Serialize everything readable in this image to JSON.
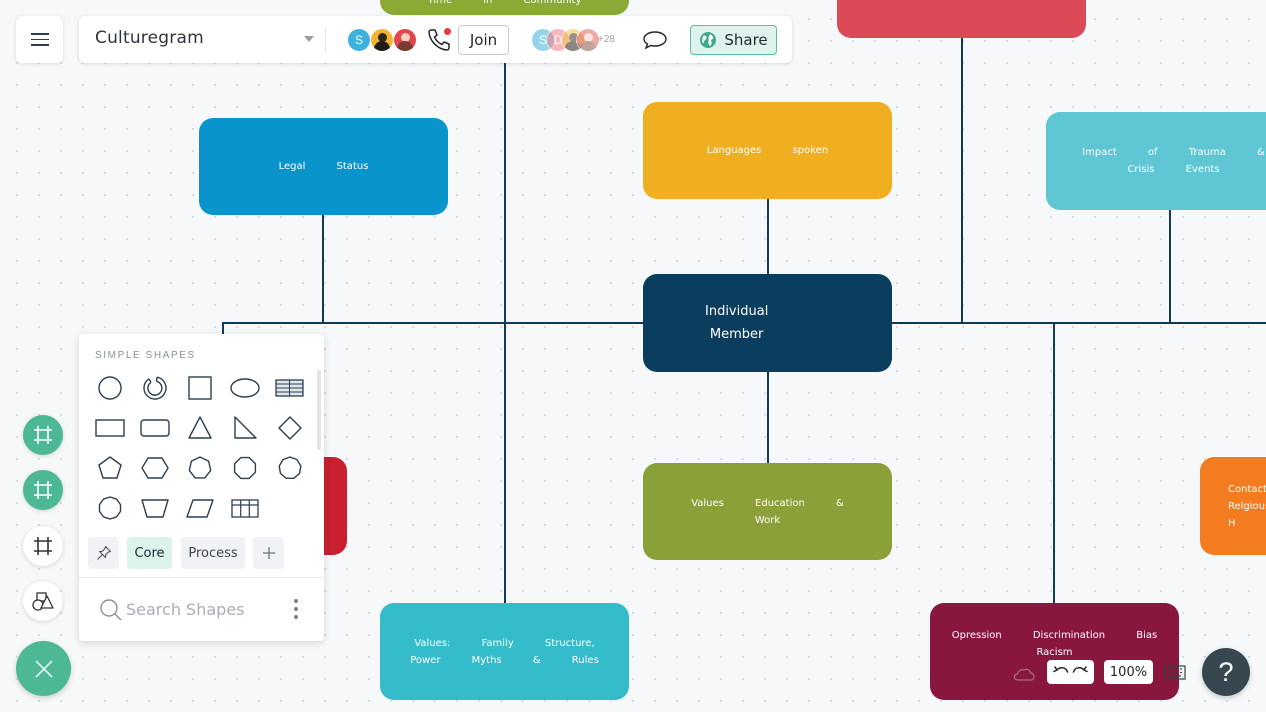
{
  "app": {
    "document_title": "Culturegram",
    "menu_icon": "hamburger-menu-icon"
  },
  "topbar": {
    "collaborators_in_call": [
      {
        "initial": "S",
        "color": "#3fb1de"
      },
      {
        "initial": "",
        "color": "#f2b531",
        "photo": true
      },
      {
        "initial": "",
        "color": "#e2474f",
        "photo": true
      }
    ],
    "call_icon": "phone-call-icon",
    "join_label": "Join",
    "viewers": [
      {
        "initial": "S",
        "color": "#3fb1de"
      },
      {
        "initial": "D",
        "color": "#ef7d86"
      },
      {
        "initial": "",
        "color": "#f2c34a",
        "photo": true
      },
      {
        "initial": "",
        "color": "#e0655f",
        "photo": true
      }
    ],
    "viewers_more": "+28",
    "comment_icon": "comment-bubble-icon",
    "share_label": "Share",
    "share_icon": "globe-icon"
  },
  "diagram": {
    "center_node": {
      "lines": [
        "Individual",
        "Member"
      ],
      "color": "#0b3d5e"
    },
    "nodes": [
      {
        "id": "time-in-community",
        "text": "Time in Community",
        "color": "#8aaa35"
      },
      {
        "id": "top-red",
        "text": "",
        "color": "#db4a56"
      },
      {
        "id": "legal-status",
        "text": "Legal Status",
        "color": "#0a94cc"
      },
      {
        "id": "languages-spoken",
        "text": "Languages spoken",
        "color": "#f0ae21"
      },
      {
        "id": "impact-of-trauma",
        "text": "Impact of Trauma & Crisis Events",
        "color": "#5ec7d3"
      },
      {
        "id": "left-red",
        "text": "",
        "color": "#c9202f"
      },
      {
        "id": "values-education-work",
        "text": "Values Education & Work",
        "color": "#8ca03a"
      },
      {
        "id": "contact-religious",
        "text": "Contact Relgious H",
        "color": "#f47c20"
      },
      {
        "id": "values-family",
        "text": "Values: Family Structure, Power Myths & Rules",
        "color": "#34bccb"
      },
      {
        "id": "opression",
        "text": "Opression Discrimination Bias Racism",
        "color": "#88163e"
      }
    ],
    "connector_color": "#123a55"
  },
  "left_rail": {
    "buttons": [
      {
        "name": "frame-tool-active",
        "icon": "frame-grid-icon",
        "style": "green"
      },
      {
        "name": "frame-tool-secondary",
        "icon": "frame-grid-icon",
        "style": "green"
      },
      {
        "name": "frame-tool",
        "icon": "frame-grid-icon",
        "style": "white"
      },
      {
        "name": "shapes-tool",
        "icon": "shapes-icon",
        "style": "white"
      }
    ],
    "close_icon": "close-icon"
  },
  "shapes_panel": {
    "heading": "SIMPLE SHAPES",
    "shapes": [
      "circle",
      "donut",
      "square",
      "ellipse",
      "table-lines",
      "rectangle",
      "rounded-rectangle",
      "triangle",
      "right-triangle",
      "diamond",
      "pentagon",
      "hexagon",
      "heptagon",
      "octagon",
      "nonagon",
      "decagon",
      "trapezoid",
      "parallelogram",
      "table-grid"
    ],
    "tabs": [
      {
        "label": "",
        "icon": "pin-icon"
      },
      {
        "label": "Core",
        "active": true
      },
      {
        "label": "Process"
      },
      {
        "label": "",
        "icon": "plus-icon"
      }
    ],
    "search_placeholder": "Search Shapes",
    "more_icon": "more-vertical-icon"
  },
  "bottom_controls": {
    "undo_icon": "undo-icon",
    "redo_icon": "redo-icon",
    "zoom_level": "100%",
    "keyboard_icon": "keyboard-icon",
    "help_label": "?"
  },
  "colors": {
    "accent": "#4cb896",
    "share_bg": "#dff3ee",
    "help_bg": "#37474f"
  }
}
